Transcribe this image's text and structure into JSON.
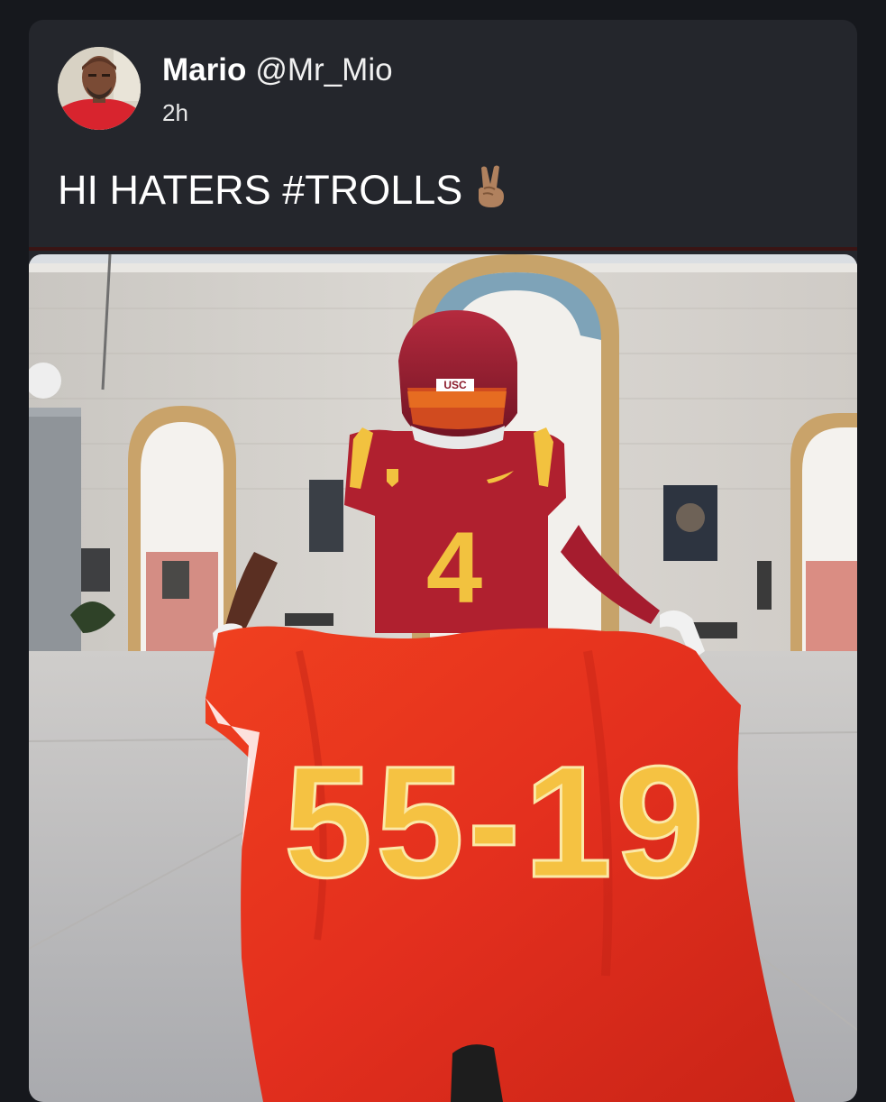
{
  "post": {
    "author_name": "Mario",
    "author_handle": "@Mr_Mio",
    "time": "2h",
    "text": "HI HATERS #TROLLS",
    "emoji_icon": "victory-hand-icon"
  },
  "image": {
    "jersey_number": "4",
    "helmet_text": "USC",
    "flag_score": "55-19"
  },
  "colors": {
    "background": "#16181d",
    "card": "#24262c",
    "cardinal": "#9b1b30",
    "gold": "#f5c242",
    "flag_red": "#e8321f"
  }
}
